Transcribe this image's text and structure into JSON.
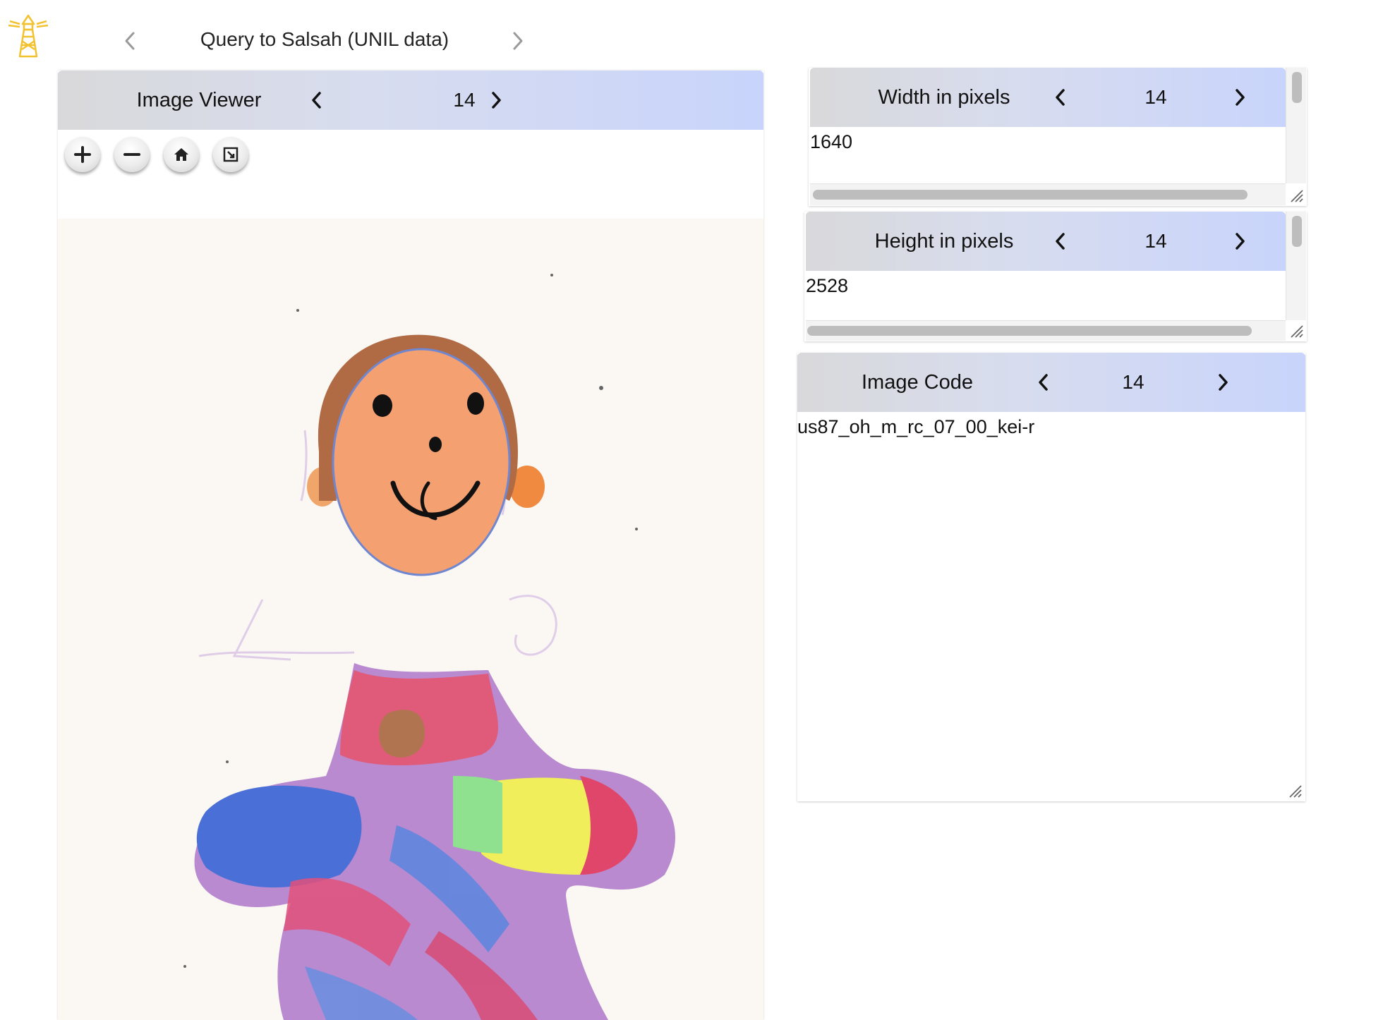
{
  "header": {
    "title": "Query to Salsah (UNIL data)",
    "prev_icon": "chevron-left-icon",
    "next_icon": "chevron-right-icon",
    "logo_icon": "lighthouse-icon"
  },
  "viewer": {
    "title": "Image Viewer",
    "index": "14",
    "controls": [
      "zoom-in-icon",
      "zoom-out-icon",
      "home-icon",
      "fullscreen-icon"
    ],
    "image": "child drawing of a person"
  },
  "width_panel": {
    "title": "Width in pixels",
    "index": "14",
    "value": "1640"
  },
  "height_panel": {
    "title": "Height in pixels",
    "index": "14",
    "value": "2528"
  },
  "code_panel": {
    "title": "Image Code",
    "index": "14",
    "value": "us87_oh_m_rc_07_00_kei-r"
  },
  "colors": {
    "header_gradient_start": "#d9d9db",
    "header_gradient_end": "#c8d4fb",
    "logo": "#f2c230"
  }
}
